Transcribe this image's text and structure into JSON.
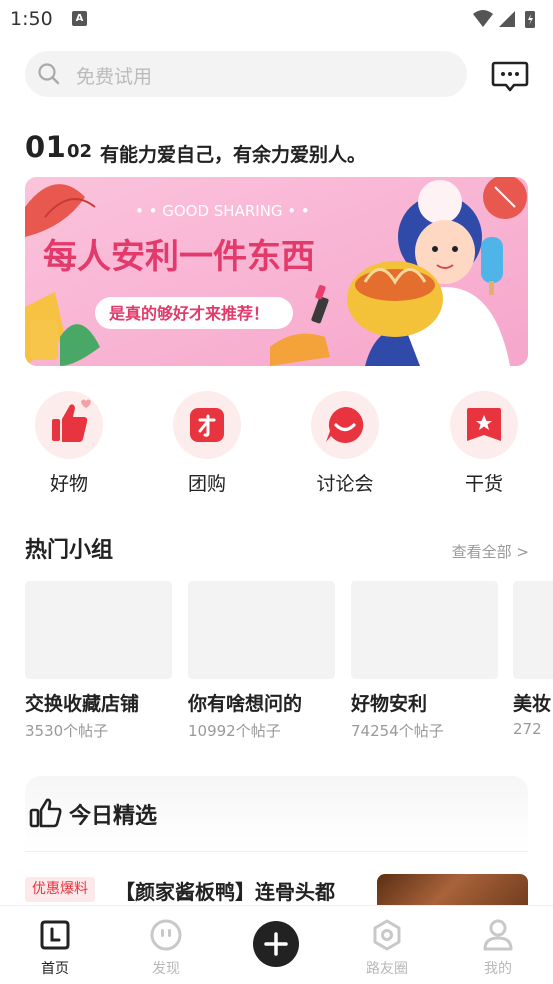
{
  "status_bar": {
    "time": "1:50",
    "notification_icon": "A"
  },
  "search": {
    "placeholder": "免费试用"
  },
  "slogan": {
    "index": "01",
    "next_index": "02",
    "text": "有能力爱自己，有余力爱别人。"
  },
  "banner": {
    "subtitle": "• • GOOD SHARING • •",
    "title": "每人安利一件东西",
    "tagline": "是真的够好才来推荐！"
  },
  "quick_entries": [
    {
      "label": "好物",
      "icon": "thumbs-up-icon"
    },
    {
      "label": "团购",
      "icon": "group-buy-icon"
    },
    {
      "label": "讨论会",
      "icon": "discussion-icon"
    },
    {
      "label": "干货",
      "icon": "bookmark-icon"
    }
  ],
  "hot_groups": {
    "title": "热门小组",
    "see_all": "查看全部 >",
    "items": [
      {
        "name": "交换收藏店铺",
        "count": "3530个帖子"
      },
      {
        "name": "你有啥想问的",
        "count": "10992个帖子"
      },
      {
        "name": "好物安利",
        "count": "74254个帖子"
      },
      {
        "name": "美妆",
        "count": "272"
      }
    ]
  },
  "today_pick": {
    "title": "今日精选",
    "article": {
      "tag": "优惠爆料",
      "title": "【颜家酱板鸭】连骨头都"
    }
  },
  "tab_bar": {
    "items": [
      {
        "label": "首页",
        "active": true
      },
      {
        "label": "发现",
        "active": false
      },
      {
        "label": "",
        "icon": "add-icon"
      },
      {
        "label": "路友圈",
        "active": false
      },
      {
        "label": "我的",
        "active": false
      }
    ]
  },
  "colors": {
    "accent": "#e8343f",
    "primary_text": "#222222",
    "secondary_text": "#999999",
    "banner_bg": "#f9b8d4"
  }
}
